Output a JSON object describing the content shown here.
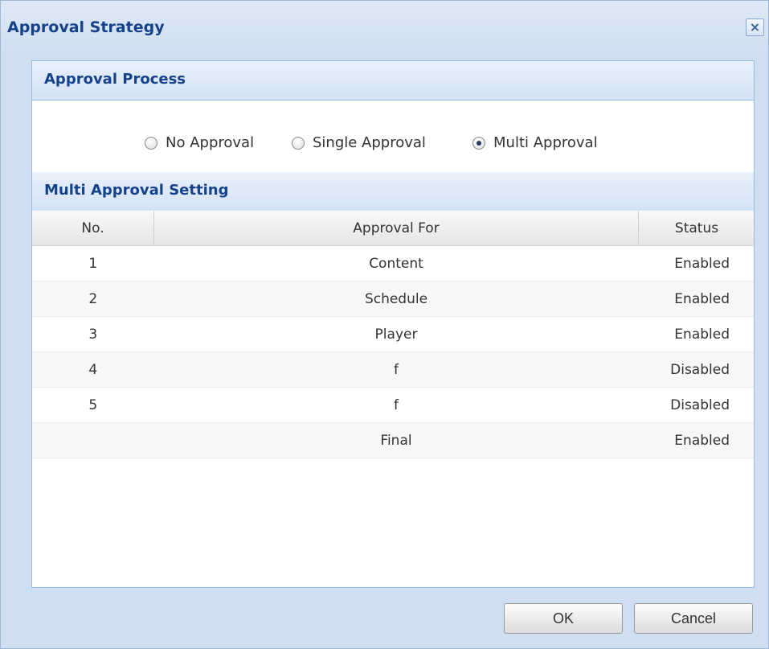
{
  "dialog": {
    "title": "Approval Strategy",
    "close_icon": "close-icon"
  },
  "approval_process": {
    "heading": "Approval Process",
    "options": [
      {
        "label": "No Approval",
        "selected": false
      },
      {
        "label": "Single Approval",
        "selected": false
      },
      {
        "label": "Multi Approval",
        "selected": true
      }
    ]
  },
  "multi_setting": {
    "heading": "Multi Approval Setting",
    "columns": [
      "No.",
      "Approval For",
      "Status"
    ],
    "rows": [
      {
        "no": "1",
        "for": "Content",
        "status": "Enabled"
      },
      {
        "no": "2",
        "for": "Schedule",
        "status": "Enabled"
      },
      {
        "no": "3",
        "for": "Player",
        "status": "Enabled"
      },
      {
        "no": "4",
        "for": "f",
        "status": "Disabled"
      },
      {
        "no": "5",
        "for": "f",
        "status": "Disabled"
      },
      {
        "no": "",
        "for": "Final",
        "status": "Enabled"
      }
    ]
  },
  "buttons": {
    "ok": "OK",
    "cancel": "Cancel"
  }
}
